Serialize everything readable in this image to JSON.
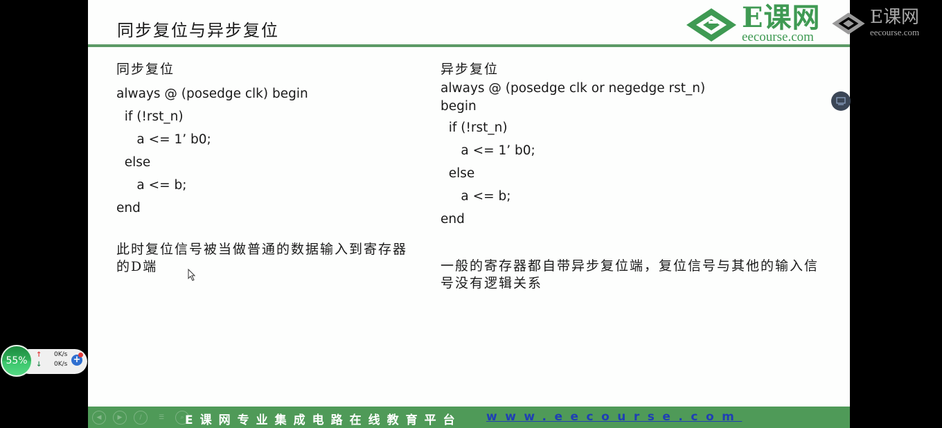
{
  "slide": {
    "title": "同步复位与异步复位",
    "logo": {
      "brand": "E课网",
      "url": "eecourse.com"
    },
    "left": {
      "heading": "同步复位",
      "code": [
        "always @ (posedge clk) begin",
        "  if (!rst_n)",
        "     a <= 1’ b0;",
        "  else",
        "     a <= b;",
        "end"
      ],
      "note": "此时复位信号被当做普通的数据输入到寄存器的D端"
    },
    "right": {
      "heading": "异步复位",
      "code": [
        "always @ (posedge clk or negedge rst_n)",
        "begin",
        "  if (!rst_n)",
        "     a <= 1’ b0;",
        "  else",
        "     a <= b;",
        "end"
      ],
      "note": "一般的寄存器都自带异步复位端，复位信号与其他的输入信号没有逻辑关系"
    },
    "footer": {
      "slogan": "E课网专业集成电路在线教育平台",
      "url": "www.eecourse.com",
      "controls": [
        "prev-icon",
        "next-icon",
        "pen-icon",
        "menu-icon",
        "zoom-icon"
      ]
    }
  },
  "watermark": {
    "brand": "E课网",
    "url": "eecourse.com"
  },
  "side_button": {
    "icon": "screen-icon"
  },
  "net_widget": {
    "percent": "55%",
    "upload": "0K/s",
    "download": "0K/s",
    "add_label": "+"
  },
  "colors": {
    "accent_green": "#4f9a58",
    "logo_green": "#3f9a53",
    "url_blue": "#1f3fb5"
  }
}
